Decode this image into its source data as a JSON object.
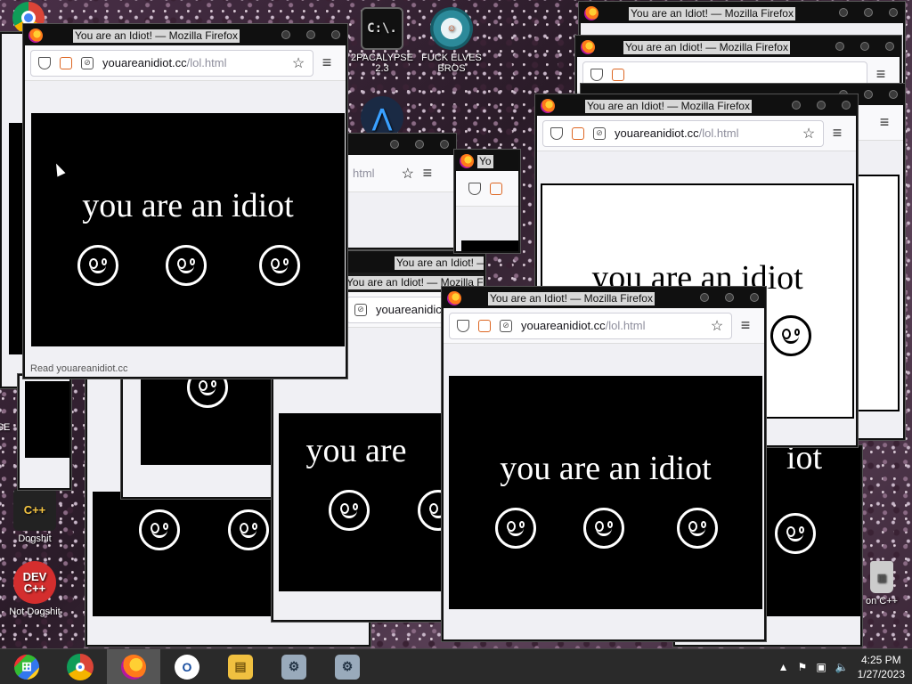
{
  "desktop": {
    "icons": [
      {
        "label": "2PACALYPSE 2.3",
        "glyph": "C:\\."
      },
      {
        "label": "FUCK ELVES BROS",
        "glyph": "☺"
      },
      {
        "label": "Dogshit",
        "glyph": "C++"
      },
      {
        "label": "Not Dogshit",
        "glyph": "DEV C++"
      },
      {
        "label": "SE",
        "glyph": ""
      },
      {
        "label": "on C++",
        "glyph": ""
      }
    ]
  },
  "window": {
    "title": "You are an Idiot! — Mozilla Firefox",
    "title_partial": "You are an Idiot! — Mozilla Firefox",
    "url_host": "youareanidiot.cc",
    "url_path": "/lol.html",
    "page_text": "you are an idiot",
    "page_text_partial": "you are",
    "page_text_fragment": "iot",
    "status_text": "Read youareanidiot.cc",
    "title_fragment": "Yo",
    "url_fragment": "html",
    "url_fragment2": "youareanidic"
  },
  "taskbar": {
    "apps": [
      {
        "name": "start-button",
        "glyph": "⊞"
      },
      {
        "name": "chrome",
        "glyph": ""
      },
      {
        "name": "firefox",
        "glyph": ""
      },
      {
        "name": "obama-app",
        "glyph": "O"
      },
      {
        "name": "file-explorer",
        "glyph": "▤"
      },
      {
        "name": "installer-1",
        "glyph": "⚙"
      },
      {
        "name": "installer-2",
        "glyph": "⚙"
      }
    ],
    "time": "4:25 PM",
    "date": "1/27/2023"
  },
  "colors": {
    "page_black": "#000000",
    "page_white": "#ffffff",
    "taskbar": "#2a2a2a",
    "titlebar": "#101010"
  }
}
